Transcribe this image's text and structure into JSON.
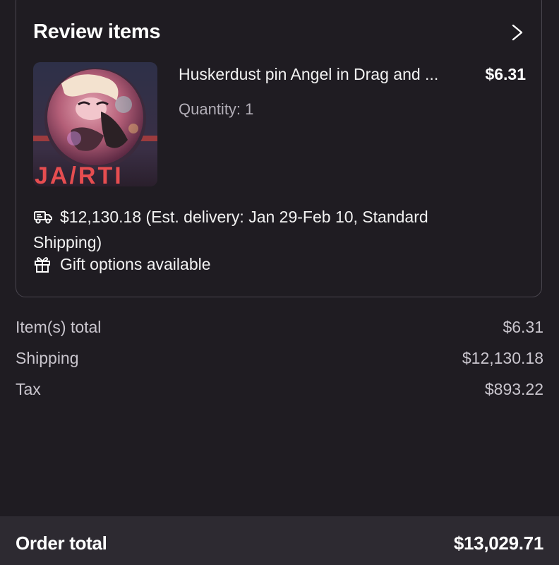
{
  "review": {
    "title": "Review items",
    "item": {
      "name": "Huskerdust pin Angel in Drag and ...",
      "price": "$6.31",
      "quantity": "Quantity: 1"
    },
    "shipping_info": "$12,130.18  (Est. delivery: Jan 29-Feb 10, Standard Shipping)",
    "gift_options": "Gift options available"
  },
  "summary": {
    "rows": [
      {
        "label": "Item(s) total",
        "value": "$6.31"
      },
      {
        "label": "Shipping",
        "value": "$12,130.18"
      },
      {
        "label": "Tax",
        "value": "$893.22"
      }
    ]
  },
  "footer": {
    "label": "Order total",
    "value": "$13,029.71"
  },
  "icons": {
    "chevron": "chevron-right-icon",
    "shipping": "delivery-truck-icon",
    "gift": "gift-icon"
  },
  "colors": {
    "background": "#1f1c22",
    "card_border": "#4a464f",
    "footer_bg": "#2d2a31",
    "muted_text": "#b3afb8"
  }
}
